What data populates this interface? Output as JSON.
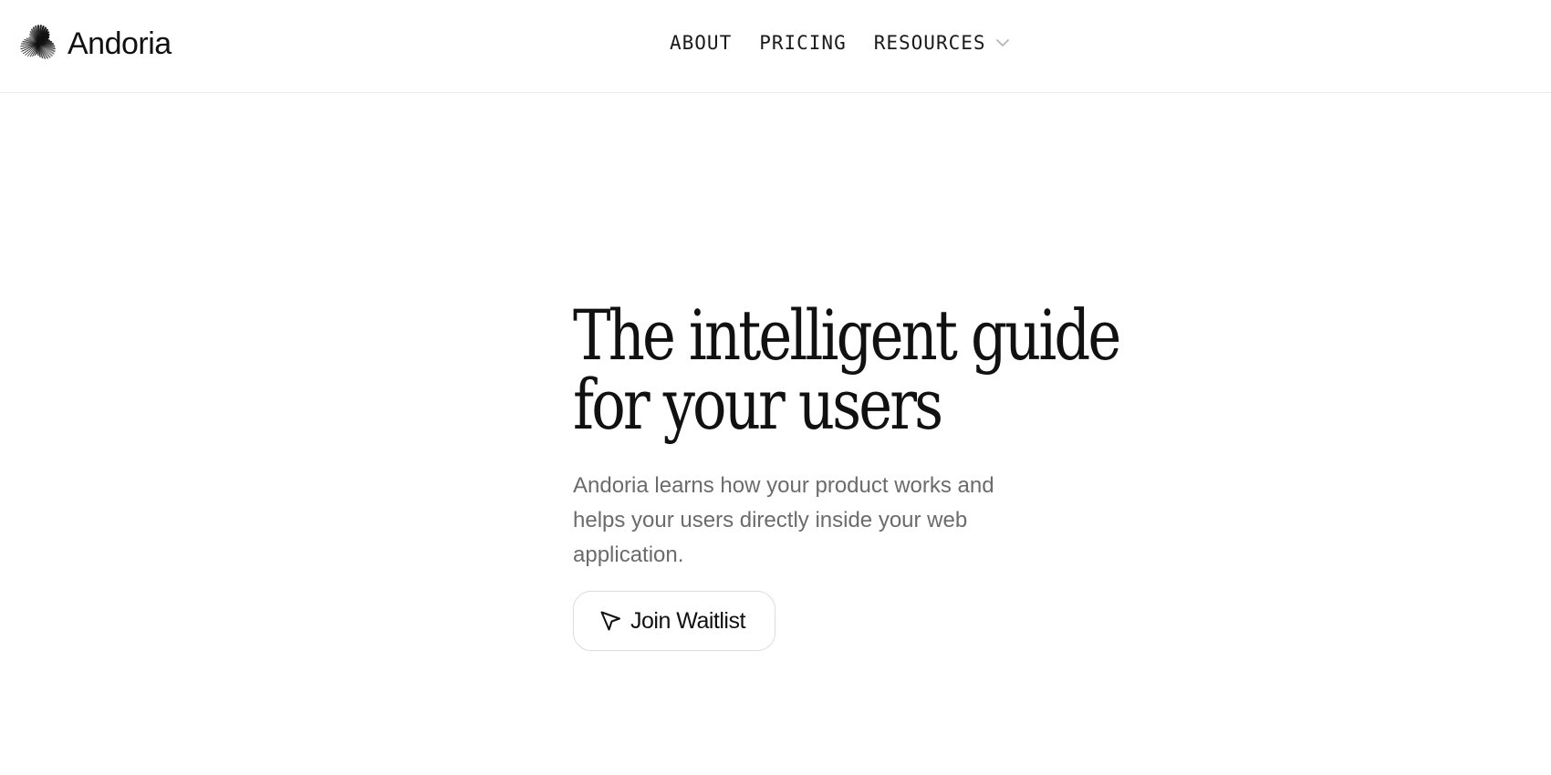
{
  "header": {
    "brand_name": "Andoria",
    "nav": [
      {
        "label": "ABOUT"
      },
      {
        "label": "PRICING"
      },
      {
        "label": "RESOURCES",
        "icon": "chevron-down-icon"
      }
    ]
  },
  "hero": {
    "title_line1": "The intelligent guide",
    "title_line2": "for your users",
    "subtitle": "Andoria learns how your product works and helps your users directly inside your web application.",
    "cta_label": "Join Waitlist",
    "cta_icon": "cursor-arrow-icon"
  },
  "colors": {
    "text": "#111111",
    "muted": "#6b6b6b",
    "border": "#dcdcdc",
    "chevron": "#b5b5b5"
  }
}
